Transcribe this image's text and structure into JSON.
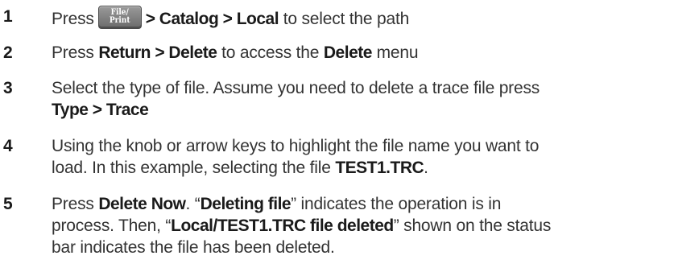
{
  "steps": [
    {
      "number": "1",
      "key_top": "File/",
      "key_bottom": "Print",
      "press": "Press",
      "bold_path": "> Catalog > Local",
      "rest": "to select the path"
    },
    {
      "number": "2",
      "press": "Press",
      "bold_path": "Return > Delete",
      "mid": "to access the",
      "bold_menu": "Delete",
      "end": "menu"
    },
    {
      "number": "3",
      "line1": "Select the type of file. Assume you need to delete a trace file press",
      "bold_line2": "Type > Trace"
    },
    {
      "number": "4",
      "line1": "Using the knob or arrow keys to highlight the file name you want to",
      "line2_pre": "load. In this example, selecting the file",
      "bold_file": "TEST1.TRC",
      "line2_end": "."
    },
    {
      "number": "5",
      "press": "Press",
      "bold_delete_now": "Delete Now",
      "after_delete": ". “",
      "bold_deleting": "Deleting file",
      "line1_end": "” indicates the operation is in",
      "line2_pre": "process. Then, “",
      "bold_status": "Local/TEST1.TRC file deleted",
      "line2_end": "” shown on the status",
      "line3": "bar indicates the file has been deleted."
    }
  ]
}
